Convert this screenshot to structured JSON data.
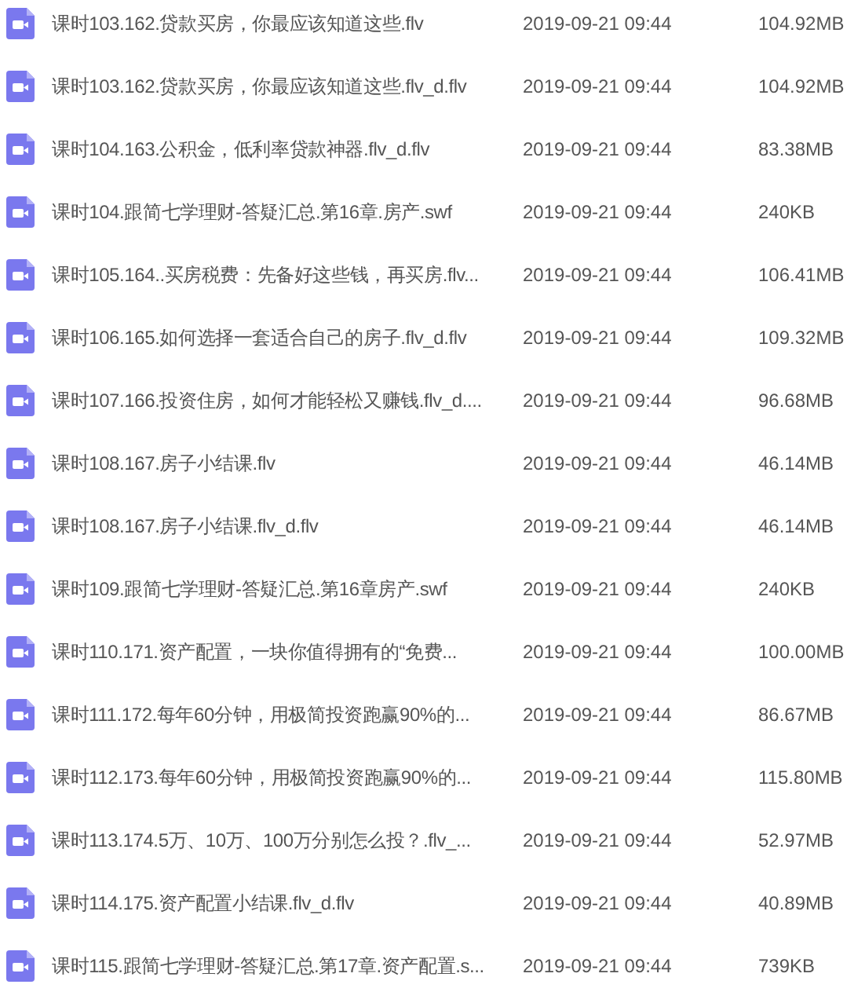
{
  "files": [
    {
      "name": "课时103.162.贷款买房，你最应该知道这些.flv",
      "modified": "2019-09-21 09:44",
      "size": "104.92MB"
    },
    {
      "name": "课时103.162.贷款买房，你最应该知道这些.flv_d.flv",
      "modified": "2019-09-21 09:44",
      "size": "104.92MB"
    },
    {
      "name": "课时104.163.公积金，低利率贷款神器.flv_d.flv",
      "modified": "2019-09-21 09:44",
      "size": "83.38MB"
    },
    {
      "name": "课时104.跟简七学理财-答疑汇总.第16章.房产.swf",
      "modified": "2019-09-21 09:44",
      "size": "240KB"
    },
    {
      "name": "课时105.164..买房税费：先备好这些钱，再买房.flv...",
      "modified": "2019-09-21 09:44",
      "size": "106.41MB"
    },
    {
      "name": "课时106.165.如何选择一套适合自己的房子.flv_d.flv",
      "modified": "2019-09-21 09:44",
      "size": "109.32MB"
    },
    {
      "name": "课时107.166.投资住房，如何才能轻松又赚钱.flv_d....",
      "modified": "2019-09-21 09:44",
      "size": "96.68MB"
    },
    {
      "name": "课时108.167.房子小结课.flv",
      "modified": "2019-09-21 09:44",
      "size": "46.14MB"
    },
    {
      "name": "课时108.167.房子小结课.flv_d.flv",
      "modified": "2019-09-21 09:44",
      "size": "46.14MB"
    },
    {
      "name": "课时109.跟简七学理财-答疑汇总.第16章房产.swf",
      "modified": "2019-09-21 09:44",
      "size": "240KB"
    },
    {
      "name": "课时110.171.资产配置，一块你值得拥有的“免费...",
      "modified": "2019-09-21 09:44",
      "size": "100.00MB"
    },
    {
      "name": "课时111.172.每年60分钟，用极简投资跑赢90%的...",
      "modified": "2019-09-21 09:44",
      "size": "86.67MB"
    },
    {
      "name": "课时112.173.每年60分钟，用极简投资跑赢90%的...",
      "modified": "2019-09-21 09:44",
      "size": "115.80MB"
    },
    {
      "name": "课时113.174.5万、10万、100万分别怎么投？.flv_...",
      "modified": "2019-09-21 09:44",
      "size": "52.97MB"
    },
    {
      "name": "课时114.175.资产配置小结课.flv_d.flv",
      "modified": "2019-09-21 09:44",
      "size": "40.89MB"
    },
    {
      "name": "课时115.跟简七学理财-答疑汇总.第17章.资产配置.s...",
      "modified": "2019-09-21 09:44",
      "size": "739KB"
    }
  ]
}
